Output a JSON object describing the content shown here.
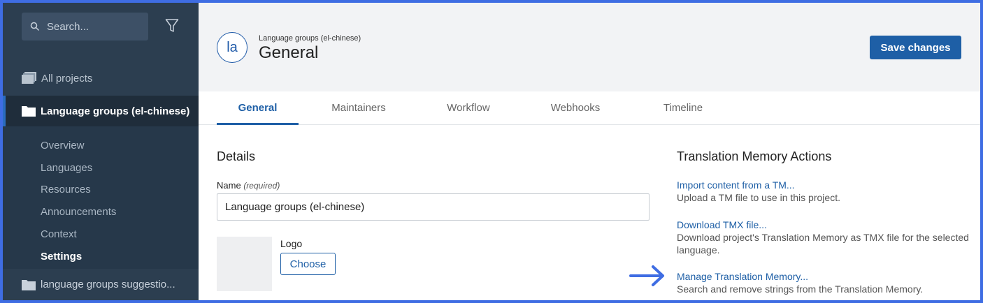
{
  "sidebar": {
    "search": {
      "placeholder": "Search..."
    },
    "all_projects": "All projects",
    "active_project": "Language groups (el-chinese)",
    "subnav": [
      {
        "label": "Overview",
        "active": false
      },
      {
        "label": "Languages",
        "active": false
      },
      {
        "label": "Resources",
        "active": false
      },
      {
        "label": "Announcements",
        "active": false
      },
      {
        "label": "Context",
        "active": false
      },
      {
        "label": "Settings",
        "active": true
      }
    ],
    "other_project": "language groups suggestio..."
  },
  "header": {
    "avatar_initials": "la",
    "breadcrumb": "Language groups (el-chinese)",
    "title": "General",
    "save_label": "Save changes"
  },
  "tabs": [
    {
      "label": "General",
      "active": true
    },
    {
      "label": "Maintainers",
      "active": false
    },
    {
      "label": "Workflow",
      "active": false
    },
    {
      "label": "Webhooks",
      "active": false
    },
    {
      "label": "Timeline",
      "active": false
    }
  ],
  "details": {
    "heading": "Details",
    "name_label": "Name",
    "name_required": "(required)",
    "name_value": "Language groups (el-chinese)",
    "logo_label": "Logo",
    "choose_label": "Choose"
  },
  "tm": {
    "heading": "Translation Memory Actions",
    "actions": [
      {
        "link": "Import content from a TM...",
        "desc": "Upload a TM file to use in this project."
      },
      {
        "link": "Download TMX file...",
        "desc": "Download project's Translation Memory as TMX file for the selected language."
      },
      {
        "link": "Manage Translation Memory...",
        "desc": "Search and remove strings from the Translation Memory."
      }
    ]
  },
  "colors": {
    "accent": "#1e5fa6",
    "sidebar_bg": "#2c3e50",
    "annotation_arrow": "#3f6de3",
    "border": "#3f6de3"
  },
  "icons": {
    "search": "search-icon",
    "filter": "filter-icon",
    "folder": "folder-icon",
    "folders": "folders-stack-icon",
    "arrow": "arrow-right-icon"
  }
}
